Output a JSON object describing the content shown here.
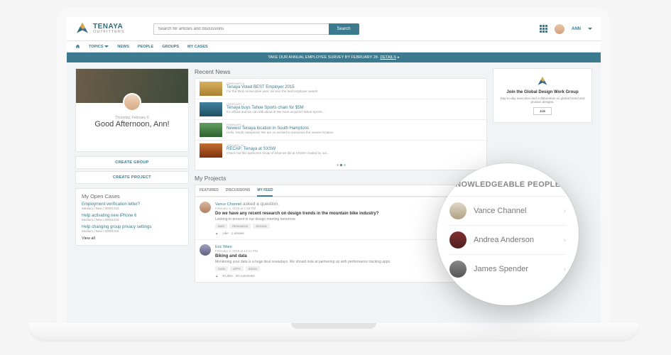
{
  "brand": {
    "name": "TENAYA",
    "sub": "OUTFITTERS"
  },
  "search": {
    "placeholder": "Search for articles and discussions",
    "button": "Search"
  },
  "user": {
    "name": "ANN"
  },
  "nav": {
    "topics": "TOPICS",
    "news": "NEWS",
    "people": "PEOPLE",
    "groups": "GROUPS",
    "mycases": "MY CASES"
  },
  "banner": {
    "text": "TAKE OUR ANNUAL EMPLOYEE SURVEY BY FEBRUARY 28.",
    "link": "DETAILS"
  },
  "hero": {
    "date": "Thursday, February 6",
    "greeting": "Good Afternoon, Ann!"
  },
  "buttons": {
    "create_group": "CREATE GROUP",
    "create_project": "CREATE PROJECT"
  },
  "cases": {
    "title": "My Open Cases",
    "items": [
      {
        "title": "Employment verification letter?",
        "meta": "Medium / New / 00001320"
      },
      {
        "title": "Help activating new iPhone 6",
        "meta": "Medium / New / 00001319"
      },
      {
        "title": "Help changing group privacy settings",
        "meta": "Medium / New / 00001318"
      }
    ],
    "view_all": "View all"
  },
  "news": {
    "title": "Recent News",
    "items": [
      {
        "date": "FEBRUARY 6",
        "title": "Tenaya Voted BEST Employer 2015",
        "sub": "For the third consecutive year, we won the best employer award!"
      },
      {
        "date": "FEBRUARY 4",
        "title": "Tenaya buys Tahoe Sports chain for $5M",
        "sub": "It's official and we can talk about it! We have acquired Tahoe Sports..."
      },
      {
        "date": "FEBRUARY 2",
        "title": "Newest Tenaya location in South Hamptons",
        "sub": "Hello, South Hamptons! We are so excited to announce the newest location"
      },
      {
        "date": "JANUARY 29",
        "title": "RECAP: Tenaya at SXSW",
        "sub": "Check out this awesome recap of what we did at SXSW created by our..."
      }
    ]
  },
  "projects": {
    "title": "My Projects",
    "tabs": {
      "featured": "FEATURED",
      "discussions": "DISCUSSIONS",
      "myfeed": "MY FEED"
    },
    "feed": [
      {
        "author": "Vance Channel",
        "action": "asked a question.",
        "time": "February 4, 2016 at 1:56 PM",
        "headline": "Do we have any recent research on design trends in the mountain bike industry?",
        "sub": "Looking to present in our design meeting tomorrow.",
        "tags": [
          "BIKE",
          "RESEARCH",
          "DESIGN"
        ],
        "foot": "Like · 1 answer"
      },
      {
        "author": "Eric Ware",
        "action": "",
        "time": "February 4, 2016 at 12:14 PM",
        "headline": "Biking and data",
        "sub": "Monitoring your data is a huge deal nowadays. We should look at partnering up with performance tracking apps.",
        "tags": [
          "DATA",
          "APPS",
          "IDEAS"
        ],
        "foot": "8 Likes · 20 comments"
      }
    ]
  },
  "group": {
    "title": "Join the Global Design Work Group",
    "sub": "Day-to-day execution and collaboration on global brand and product designs.",
    "button": "Join"
  },
  "magnifier": {
    "title": "KNOWLEDGEABLE PEOPLE",
    "people": [
      {
        "name": "Vance Channel"
      },
      {
        "name": "Andrea Anderson"
      },
      {
        "name": "James Spender"
      }
    ]
  }
}
